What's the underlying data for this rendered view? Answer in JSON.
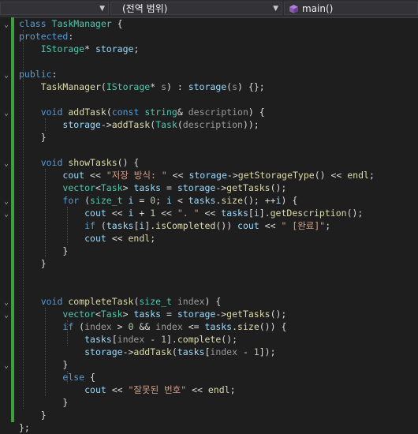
{
  "nav": {
    "scope_dropdown": "",
    "member_dropdown": "(전역 범위)",
    "function_dropdown": "main()"
  },
  "code_lines": [
    "class TaskManager {",
    "protected:",
    "    IStorage* storage;",
    "",
    "public:",
    "    TaskManager(IStorage* s) : storage(s) {};",
    "",
    "    void addTask(const string& description) {",
    "        storage->addTask(Task(description));",
    "    }",
    "",
    "    void showTasks() {",
    "        cout << \"저장 방식: \" << storage->getStorageType() << endl;",
    "        vector<Task> tasks = storage->getTasks();",
    "        for (size_t i = 0; i < tasks.size(); ++i) {",
    "            cout << i + 1 << \". \" << tasks[i].getDescription();",
    "            if (tasks[i].isCompleted()) cout << \" [완료]\";",
    "            cout << endl;",
    "        }",
    "    }",
    "",
    "    void completeTask(size_t index) {",
    "        vector<Task> tasks = storage->getTasks();",
    "        if (index > 0 && index <= tasks.size()) {",
    "            tasks[index - 1].complete();",
    "            storage->addTask(tasks[index - 1]);",
    "        }",
    "        else {",
    "            cout << \"잘못된 번호\" << endl;",
    "        }",
    "    }",
    "};"
  ]
}
